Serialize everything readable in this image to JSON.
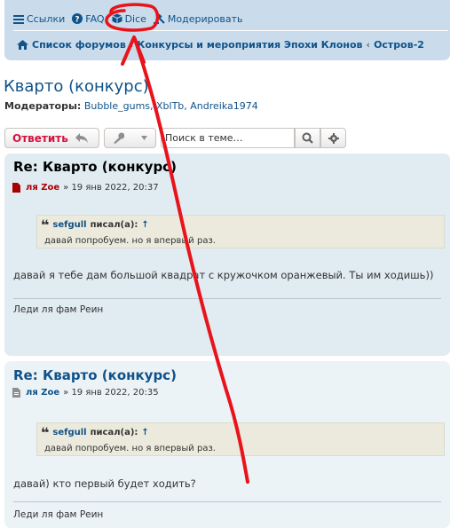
{
  "quicklinks": {
    "links_label": "Ссылки",
    "faq_label": "FAQ",
    "dice_label": "Dice",
    "moderate_label": "Модерировать"
  },
  "breadcrumbs": [
    "Список форумов",
    "Конкурсы и мероприятия Эпохи Клонов",
    "Остров-2"
  ],
  "topic": {
    "title": "Кварто (конкурс)",
    "moderators_label": "Модераторы:",
    "moderators": "Bubble_gums, XblTb, Andreika1974"
  },
  "actions": {
    "reply_label": "Ответить",
    "search_placeholder": "Поиск в теме…"
  },
  "posts": [
    {
      "title": "Re: Кварто (конкурс)",
      "author": "ля Zoe",
      "date": "» 19 янв 2022, 20:37",
      "quote_author": "sefgull",
      "quote_wrote": "писал(а):",
      "quote_arrow": "↑",
      "quote_text": "давай попробуем. но я впервый раз.",
      "text": "давай я тебе дам большой квадрат с кружочком оранжевый. Ты им ходишь))",
      "signature": "Леди ля фам Реин"
    },
    {
      "title": "Re: Кварто (конкурс)",
      "author": "ля Zoe",
      "date": "» 19 янв 2022, 20:35",
      "quote_author": "sefgull",
      "quote_wrote": "писал(а):",
      "quote_arrow": "↑",
      "quote_text": "давай попробуем. но я впервый раз.",
      "text": "давай) кто первый будет ходить?",
      "signature": "Леди ля фам Реин"
    }
  ],
  "colors": {
    "link": "#105289",
    "navbar_bg": "#cadceb",
    "post1_bg": "#e1ebf2",
    "post2_bg": "#ecf3f7",
    "quote_bg": "#ebeadd",
    "reply_text": "#d31141",
    "annotation": "#e8131b"
  },
  "icons": {
    "links": "hamburger-icon",
    "faq": "question-circle-icon",
    "dice": "cube-icon",
    "moderate": "gavel-icon",
    "home": "home-icon",
    "reply": "reply-arrow-icon",
    "tools": "wrench-icon",
    "search": "search-icon",
    "advanced_search": "gear-icon",
    "post_unread": "file-icon",
    "post_read": "file-lines-icon",
    "quote": "quote-icon"
  }
}
